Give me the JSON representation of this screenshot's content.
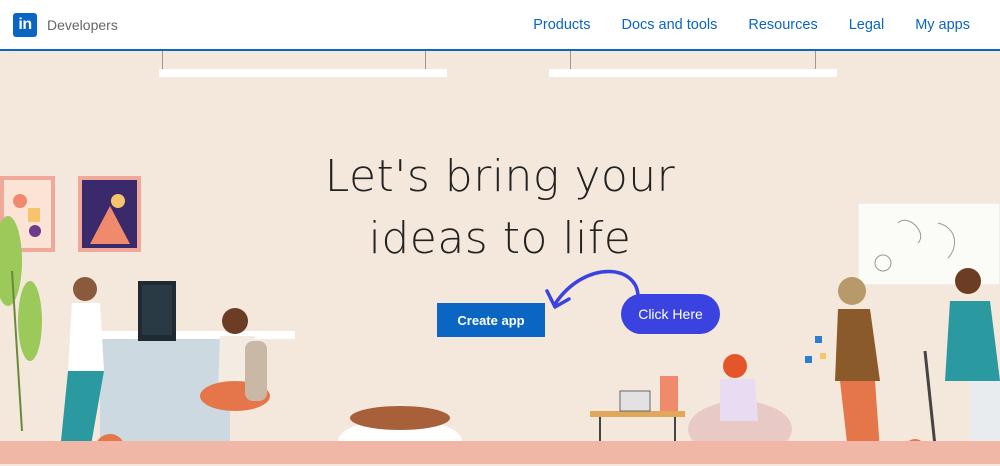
{
  "nav": {
    "logo_text": "in",
    "brand": "Developers",
    "links": [
      "Products",
      "Docs and tools",
      "Resources",
      "Legal",
      "My apps"
    ]
  },
  "hero": {
    "headline_line1": "Let's bring your",
    "headline_line2": "ideas to life",
    "cta_label": "Create app",
    "annotation_label": "Click Here"
  },
  "colors": {
    "accent": "#0a66c2",
    "bubble": "#3a43e0",
    "background": "#f4e8dc"
  }
}
